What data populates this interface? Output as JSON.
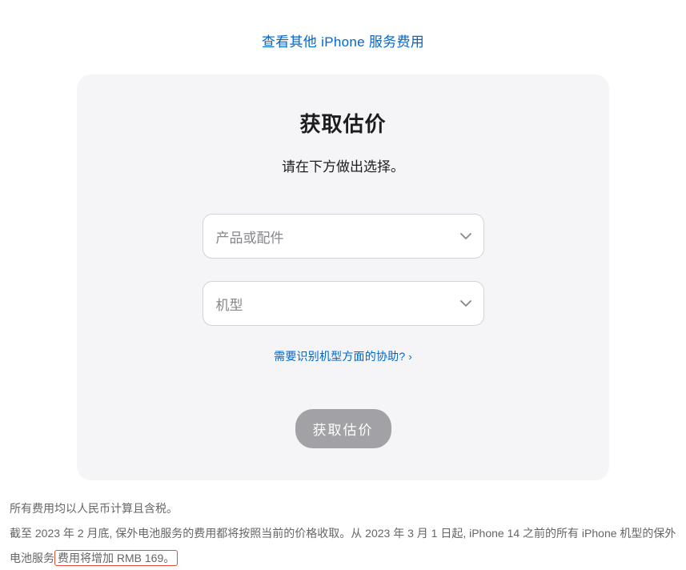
{
  "topLink": {
    "label": "查看其他 iPhone 服务费用"
  },
  "card": {
    "title": "获取估价",
    "subtitle": "请在下方做出选择。",
    "select1": {
      "placeholder": "产品或配件"
    },
    "select2": {
      "placeholder": "机型"
    },
    "helpLink": {
      "label": "需要识别机型方面的协助?",
      "arrow": "›"
    },
    "submit": {
      "label": "获取估价"
    }
  },
  "footer": {
    "line1": "所有费用均以人民币计算且含税。",
    "line2_part1": "截至 2023 年 2 月底, 保外电池服务的费用都将按照当前的价格收取。从 2023 年 3 月 1 日起, iPhone 14 之前的所有 iPhone 机型的保外电池服务",
    "line2_highlight": "费用将增加 RMB 169。"
  }
}
